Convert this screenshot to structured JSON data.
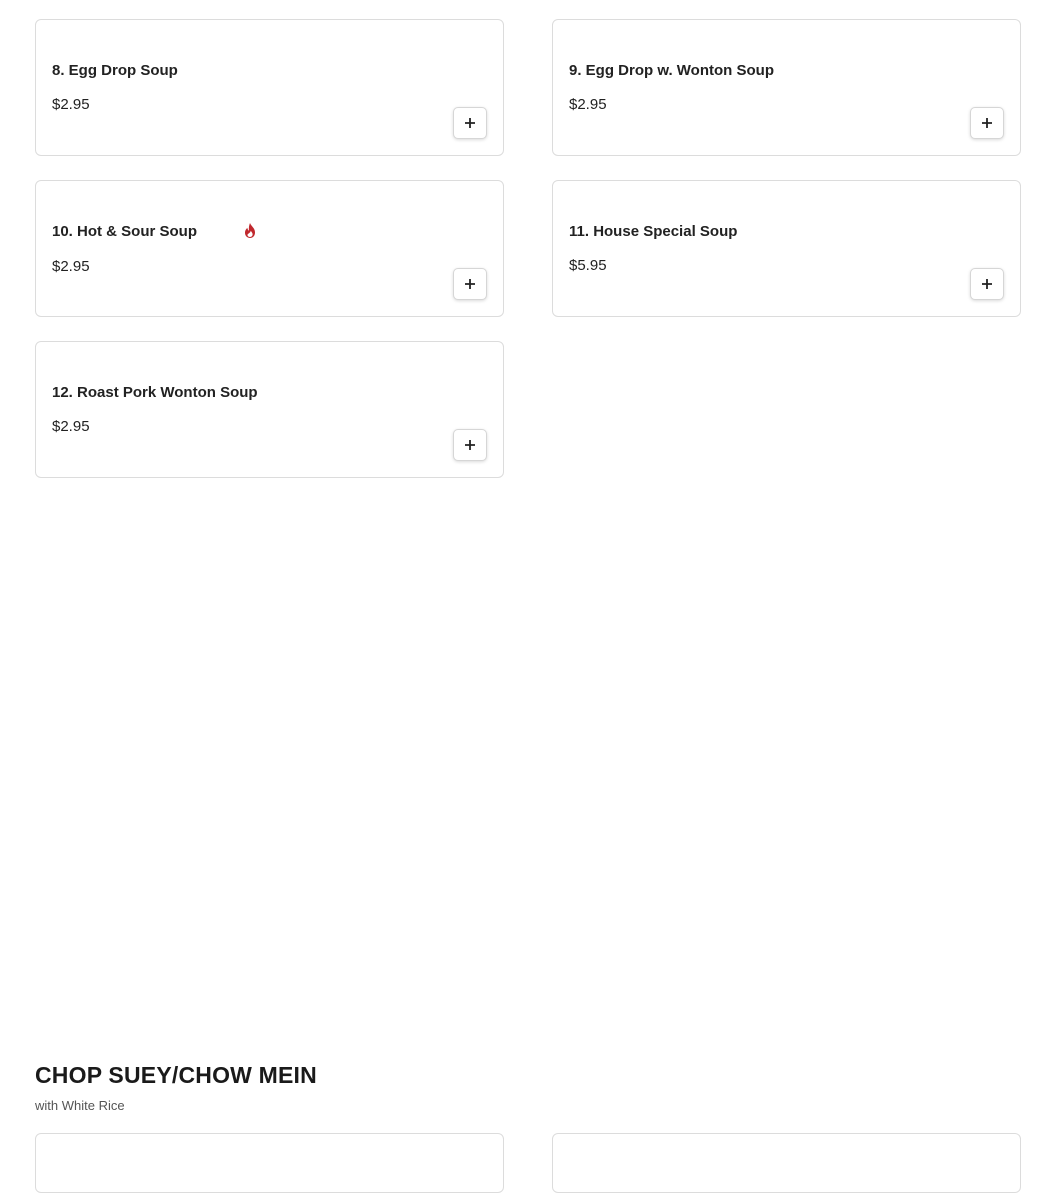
{
  "menu_items": [
    {
      "name": "8. Egg Drop Soup",
      "price": "$2.95"
    },
    {
      "name": "9. Egg Drop w. Wonton Soup",
      "price": "$2.95"
    },
    {
      "name": "10. Hot & Sour Soup",
      "price": "$2.95",
      "icon": "spicy-flame-icon",
      "icon_color": "#c0282d"
    },
    {
      "name": "11. House Special Soup",
      "price": "$5.95"
    },
    {
      "name": "12. Roast Pork Wonton Soup",
      "price": "$2.95"
    }
  ],
  "add_button_icon": "plus-icon",
  "next_section": {
    "title": "CHOP SUEY/CHOW MEIN",
    "subtitle": "with White Rice"
  }
}
